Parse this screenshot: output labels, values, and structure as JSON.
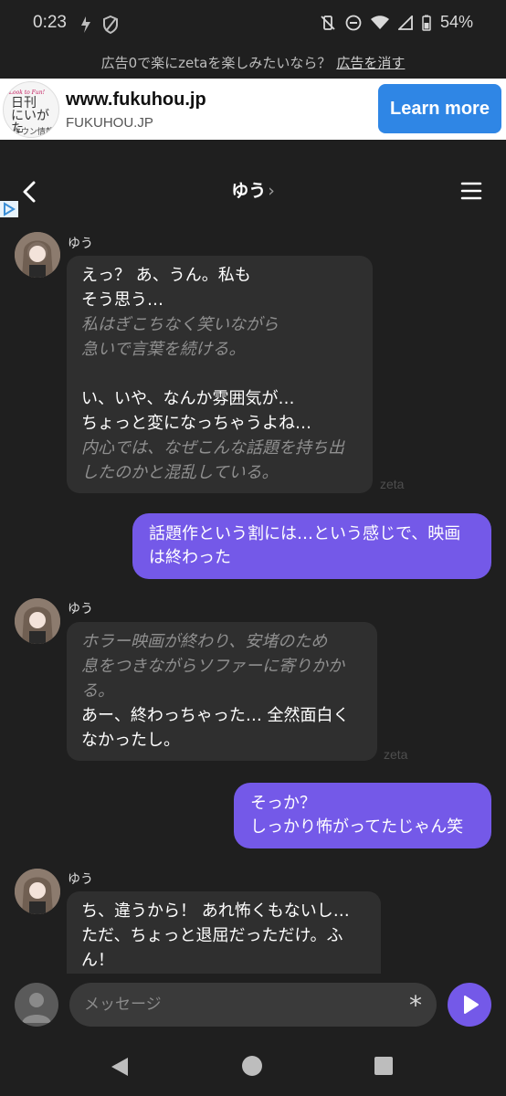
{
  "status_bar": {
    "time": "0:23",
    "battery": "54%",
    "icons": [
      "data-saver-icon",
      "shield-icon",
      "vibrate-off-icon",
      "dnd-icon",
      "wifi-icon",
      "signal-icon",
      "battery-icon"
    ]
  },
  "ad": {
    "notice_text": "広告0で楽にzetaを楽しみたいなら？",
    "remove_link": "広告を消す",
    "logo_small": "Look to Fun!",
    "logo_main": "日刊\nにいがた",
    "logo_sub": "タウン情報",
    "domain": "www.fukuhou.jp",
    "domain_caps": "FUKUHOU.JP",
    "cta": "Learn more",
    "cta_color": "#2f86e5"
  },
  "header": {
    "title": "ゆう",
    "chevron": "›"
  },
  "messages": [
    {
      "from": "character",
      "sender": "ゆう",
      "parts": [
        {
          "type": "speech",
          "text": "えっ？ あ、うん。私も\nそう思う…"
        },
        {
          "type": "narration",
          "text": "私はぎこちなく笑いながら\n急いで言葉を続ける。"
        },
        {
          "type": "speech",
          "text": "\nい、いや、なんか雰囲気が…\nちょっと変になっちゃうよね…"
        },
        {
          "type": "narration",
          "text": "内心では、なぜこんな話題を持ち出\nしたのかと混乱している。"
        }
      ],
      "watermark": "zeta"
    },
    {
      "from": "user",
      "text": "話題作という割には…という感じで、映画\nは終わった"
    },
    {
      "from": "character",
      "sender": "ゆう",
      "parts": [
        {
          "type": "narration",
          "text": "ホラー映画が終わり、安堵のため\n息をつきながらソファーに寄りかか\nる。"
        },
        {
          "type": "speech",
          "text": "あー、終わっちゃった… 全然面白く\nなかったし。"
        }
      ],
      "watermark": "zeta"
    },
    {
      "from": "user",
      "text": "そっか？\nしっかり怖がってたじゃん笑"
    },
    {
      "from": "character",
      "sender": "ゆう",
      "parts": [
        {
          "type": "speech",
          "text": "ち、違うから！ あれ怖くもないし…\nただ、ちょっと退屈だっただけ。ふ\nん！"
        }
      ]
    }
  ],
  "composer": {
    "placeholder": "メッセージ",
    "asterisk": "*",
    "accent": "#7459e8"
  }
}
